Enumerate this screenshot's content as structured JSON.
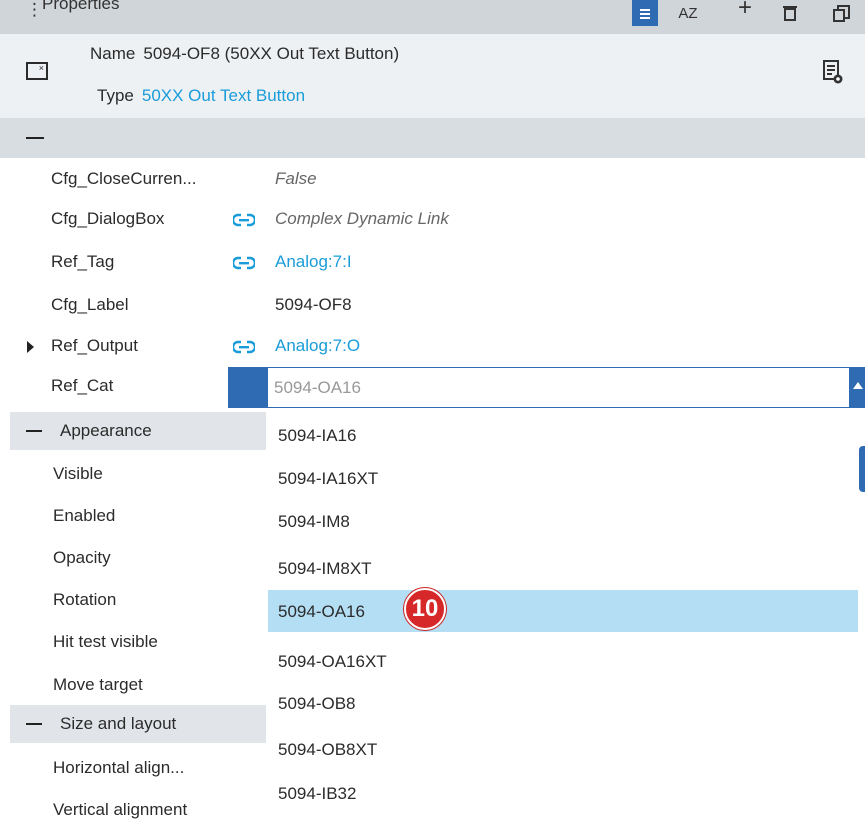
{
  "panel": {
    "title": "Properties",
    "toolbar": {
      "az_label": "AZ"
    }
  },
  "header": {
    "name_key": "Name",
    "name_value": "5094-OF8 (50XX Out Text Button)",
    "type_key": "Type",
    "type_value": "50XX Out Text Button"
  },
  "properties": [
    {
      "name": "Cfg_CloseCurren...",
      "value": "False",
      "style": "italic",
      "linked": false
    },
    {
      "name": "Cfg_DialogBox",
      "value": "Complex Dynamic Link",
      "style": "italic",
      "linked": true
    },
    {
      "name": "Ref_Tag",
      "value": "Analog:7:I",
      "style": "link",
      "linked": true
    },
    {
      "name": "Cfg_Label",
      "value": "5094-OF8",
      "style": "plain",
      "linked": false
    },
    {
      "name": "Ref_Output",
      "value": "Analog:7:O",
      "style": "link",
      "linked": true,
      "expandable": true
    },
    {
      "name": "Ref_Cat",
      "value": "5094-OA16",
      "style": "combo",
      "linked": false
    }
  ],
  "groups": {
    "appearance": {
      "label": "Appearance",
      "items": [
        "Visible",
        "Enabled",
        "Opacity",
        "Rotation",
        "Hit test visible",
        "Move target"
      ]
    },
    "size_layout": {
      "label": "Size and layout",
      "items": [
        "Horizontal align...",
        "Vertical alignment"
      ]
    }
  },
  "dropdown": {
    "selected": "5094-OA16",
    "options": [
      "5094-IA16",
      "5094-IA16XT",
      "5094-IM8",
      "5094-IM8XT",
      "5094-OA16",
      "5094-OA16XT",
      "5094-OB8",
      "5094-OB8XT",
      "5094-IB32"
    ]
  },
  "annotation": {
    "step": "10"
  },
  "colors": {
    "accent": "#2e6bb3",
    "link": "#1a9cd8",
    "selected_row": "#b3def4",
    "badge": "#d62828"
  }
}
